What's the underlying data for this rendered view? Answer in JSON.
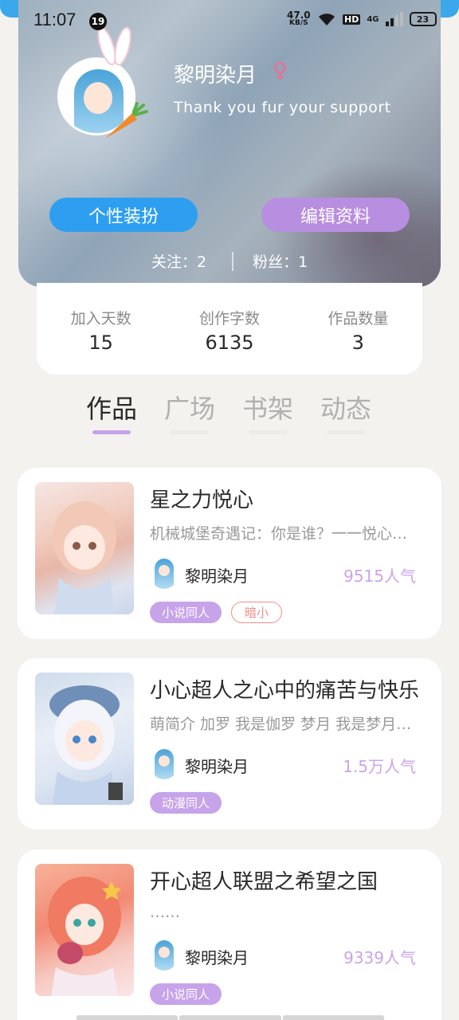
{
  "status_bar": {
    "time": "11:07",
    "notification_count": "19",
    "net_speed_value": "47.0",
    "net_speed_unit": "KB/S",
    "hd_label": "HD",
    "network_label": "4G",
    "battery": "23"
  },
  "profile": {
    "username": "黎明染月",
    "gender_symbol": "♀",
    "signature": "Thank you fur your support",
    "dress_button": "个性装扮",
    "edit_button": "编辑资料",
    "following": "关注：2",
    "followers": "粉丝：1"
  },
  "stats": [
    {
      "label": "加入天数",
      "value": "15"
    },
    {
      "label": "创作字数",
      "value": "6135"
    },
    {
      "label": "作品数量",
      "value": "3"
    }
  ],
  "tabs": [
    "作品",
    "广场",
    "书架",
    "动态"
  ],
  "active_tab": "作品",
  "works": [
    {
      "title": "星之力悦心",
      "description": "机械城堡奇遇记：你是谁？一一悦心我是谁",
      "author": "黎明染月",
      "popularity": "9515人气",
      "tags": [
        {
          "label": "小说同人",
          "style": "filled"
        },
        {
          "label": "暗小",
          "style": "outline"
        }
      ]
    },
    {
      "title": "小心超人之心中的痛苦与快乐",
      "description": "萌简介 加罗 我是伽罗 梦月 我是梦月公主",
      "author": "黎明染月",
      "popularity": "1.5万人气",
      "tags": [
        {
          "label": "动漫同人",
          "style": "filled"
        }
      ]
    },
    {
      "title": "开心超人联盟之希望之国",
      "description": "……",
      "author": "黎明染月",
      "popularity": "9339人气",
      "tags": [
        {
          "label": "小说同人",
          "style": "filled"
        }
      ]
    }
  ],
  "colors": {
    "accent_blue": "#2e9ff0",
    "accent_purple": "#b88ee0",
    "tag_purple": "#c7a3ea",
    "tag_red": "#f08b8b",
    "popularity": "#c9a4ee"
  }
}
